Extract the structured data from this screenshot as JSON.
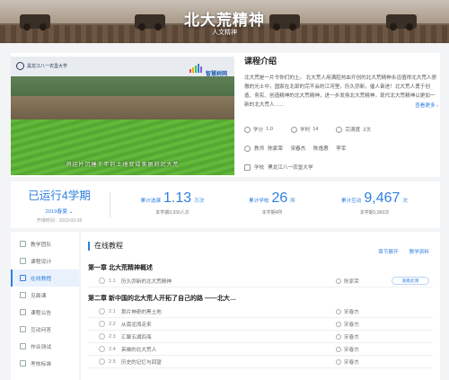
{
  "hero": {
    "title": "北大荒精神",
    "subtitle": "人文精神"
  },
  "video": {
    "school_logo_text": "黑龙江八一农垦大学",
    "brand_text": "智慧树网",
    "caption": "将这片沉睡千年的土地变成美丽的北大荒"
  },
  "course": {
    "intro_title": "课程介绍",
    "description": "北大荒是一片令你们的土。 北大荒人用满腔热血开创的北大荒精神永远值得北大荒人骄傲的光士中，国家在北部的完不会的江河里，历久弥新，催人奋进！北大荒人勇于创造、务实、创造精神的北大荒精神，进一步发扬北大荒精神，现代北大荒精神以更加一新的北大荒人……",
    "more_label": "查看更多 ›",
    "credits_label": "学分",
    "credits_value": "1.0",
    "hours_label": "学时",
    "hours_value": "14",
    "completions_label": "完满度",
    "completions_value": "2次",
    "teachers_label": "教师",
    "teachers": [
      "陈家荣",
      "宋春杰",
      "陈逸惠",
      "李军"
    ],
    "school_label": "学校",
    "school": "黑龙江八一农垦大学"
  },
  "stats": {
    "run_title": "已运行4学期",
    "run_term": "2019春夏 ⌄",
    "run_date": "开课时间：2019-03-26",
    "select": {
      "label": "累计选课",
      "value": "1.13",
      "unit": "万次",
      "sub": "本学期3,930人次"
    },
    "schools": {
      "label": "累计学校",
      "value": "26",
      "unit": "所",
      "sub": "本学期4所"
    },
    "interact": {
      "label": "累计互动",
      "value": "9,467",
      "unit": "次",
      "sub": "本学期1,960次"
    }
  },
  "sidebar": {
    "items": [
      {
        "label": "教学团队"
      },
      {
        "label": "课程设计"
      },
      {
        "label": "在线教程"
      },
      {
        "label": "见面课"
      },
      {
        "label": "课程公告"
      },
      {
        "label": "互动问答"
      },
      {
        "label": "作业测试"
      },
      {
        "label": "考核标准"
      }
    ],
    "active_index": 2
  },
  "main": {
    "title": "在线教程",
    "link_tree": "章节展开",
    "link_download": "教学资料",
    "chapters": [
      {
        "title": "第一章  北大荒精神概述",
        "lessons": [
          {
            "num": "1.1",
            "title": "历久弥新的北大荒精神",
            "teacher": "陈家荣",
            "tag": "观看此课"
          }
        ]
      },
      {
        "title": "第二章  新中国的北大荒人开拓了自己的路 ——北大…",
        "lessons": [
          {
            "num": "2.1",
            "title": "那片神奇的黑土地",
            "teacher": "宋春杰",
            "tag": ""
          },
          {
            "num": "2.2",
            "title": "从南泥湾走来",
            "teacher": "宋春杰",
            "tag": ""
          },
          {
            "num": "2.3",
            "title": "汇聚五湖四海",
            "teacher": "宋春杰",
            "tag": ""
          },
          {
            "num": "2.4",
            "title": "英雄的北大荒人",
            "teacher": "宋春杰",
            "tag": ""
          },
          {
            "num": "2.5",
            "title": "历史的记忆与回望",
            "teacher": "宋春杰",
            "tag": ""
          }
        ]
      }
    ]
  },
  "colors": {
    "accent": "#2f7fe0",
    "active_bg": "#e9f1fc"
  }
}
